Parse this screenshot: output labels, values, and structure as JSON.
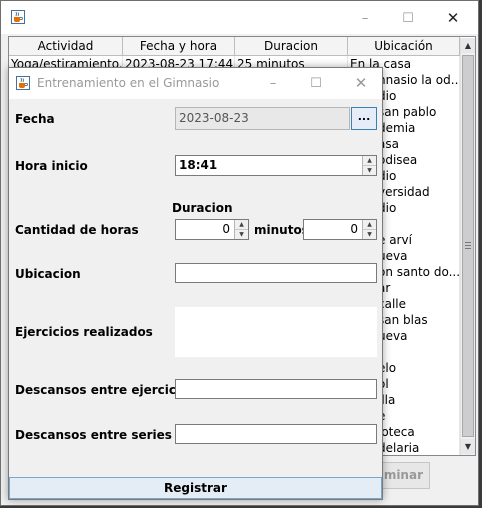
{
  "main_window": {
    "table": {
      "headers": [
        "Actividad",
        "Fecha y hora",
        "Duracion",
        "Ubicación"
      ],
      "first_row": [
        "Yoga/estiramiento...",
        "2023-08-23 17:44",
        "25 minutos",
        "En la casa"
      ],
      "ubicacion_visible": [
        "nnasio la od...",
        "dio",
        "san pablo",
        "demia",
        "asa",
        "odisea",
        "dio",
        "versidad",
        "dio",
        "",
        "e arví",
        "ueva",
        "on santo do...",
        "ar",
        "calle",
        "san blas",
        "ueva",
        "",
        "elo",
        "ol",
        "illa",
        "e",
        "ioteca",
        "delaria"
      ]
    },
    "eliminar_button": "minar"
  },
  "dialog": {
    "title": "Entrenamiento en el Gimnasio",
    "fecha_label": "Fecha",
    "fecha_value": "2023-08-23",
    "date_picker_button": "...",
    "hora_inicio_label": "Hora inicio",
    "hora_inicio_value": "18:41",
    "duracion_label": "Duracion",
    "cantidad_horas_label": "Cantidad de horas",
    "horas_value": "0",
    "minutos_label": "minutos",
    "minutos_value": "0",
    "ubicacion_label": "Ubicacion",
    "ubicacion_value": "",
    "ejercicios_label": "Ejercicios realizados",
    "ejercicios_value": "",
    "descansos_ejercicios_label": "Descansos entre ejercicios",
    "descansos_ejercicios_value": "",
    "descansos_series_label": "Descansos entre series",
    "descansos_series_value": "",
    "registrar_button": "Registrar"
  },
  "icons": {
    "app": "java-cup-icon",
    "minimize": "minimize-icon",
    "maximize": "maximize-icon",
    "close": "close-icon"
  },
  "colors": {
    "date_button_border": "#3c7fb1",
    "registrar_button_bg": "#e4ecf5"
  }
}
